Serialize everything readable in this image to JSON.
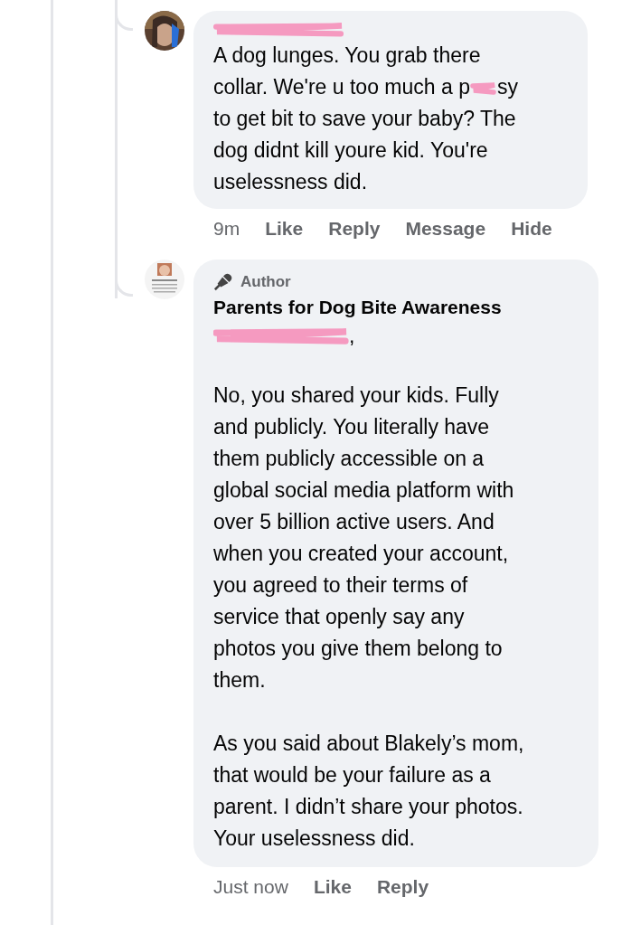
{
  "comments": [
    {
      "avatar": {
        "kind": "picture"
      },
      "name_redacted": true,
      "paragraphs": [
        {
          "before": "A dog lunges. You grab there\ncollar. We're u too much a p",
          "redacted": true,
          "after": "sy\nto get bit to save your baby? The\ndog didnt kill youre kid. You're\nuselessness did."
        }
      ],
      "time": "9m",
      "actions": [
        "Like",
        "Reply",
        "Message",
        "Hide"
      ]
    },
    {
      "avatar": {
        "kind": "picture"
      },
      "author_badge": "Author",
      "name": "Parents for Dog Bite Awareness",
      "mention_redacted": true,
      "mention_suffix": ",",
      "paragraphs": [
        {
          "before": "No, you shared your kids. Fully\nand publicly. You literally have\nthem publicly accessible on a\nglobal social media platform with\nover 5 billion active users. And\nwhen you created your account,\nyou agreed to their terms of\nservice that openly say any\nphotos you give them belong to\nthem.",
          "redacted": false
        },
        {
          "before": "As you said about Blakely’s mom,\nthat would be your failure as a\nparent. I didn’t share your photos.\nYour uselessness did.",
          "redacted": false
        }
      ],
      "time": "Just now",
      "actions": [
        "Like",
        "Reply"
      ]
    }
  ]
}
